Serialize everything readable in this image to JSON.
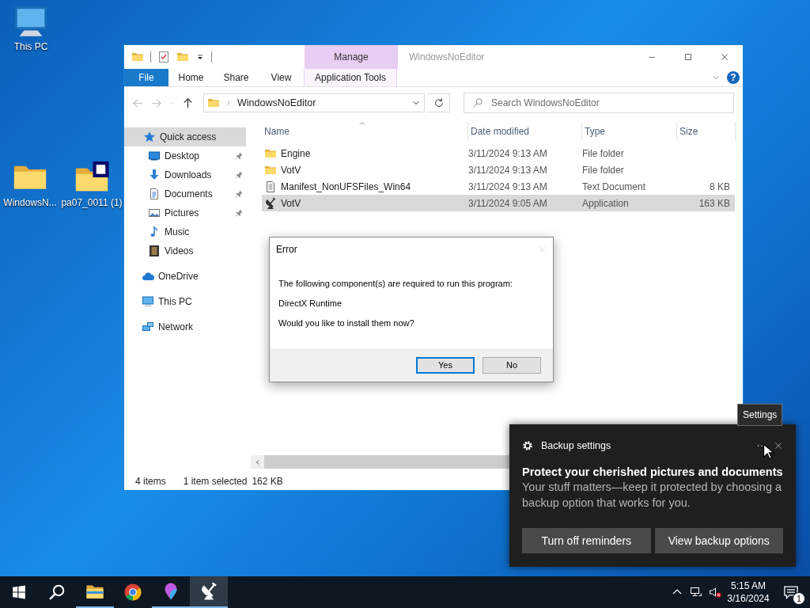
{
  "desktop_icons": [
    {
      "kind": "computer",
      "label": "This PC"
    },
    {
      "kind": "folder",
      "label": "WindowsN..."
    },
    {
      "kind": "archive",
      "label": "pa07_0011 (1)"
    }
  ],
  "explorer": {
    "contextual_group": "Manage",
    "title": "WindowsNoEditor",
    "ribbon_tabs": [
      {
        "kind": "file",
        "label": "File"
      },
      {
        "kind": "plain",
        "label": "Home"
      },
      {
        "kind": "plain",
        "label": "Share"
      },
      {
        "kind": "plain",
        "label": "View"
      },
      {
        "kind": "contextual",
        "label": "Application Tools"
      }
    ],
    "help": "?",
    "address": "WindowsNoEditor",
    "search": {
      "placeholder": "Search WindowsNoEditor"
    },
    "nav": [
      {
        "kind": "star",
        "label": "Quick access",
        "selected": true,
        "children": [
          {
            "kind": "desktop",
            "label": "Desktop",
            "pinned": true,
            "selected": false
          },
          {
            "kind": "download",
            "label": "Downloads",
            "pinned": true,
            "selected": false
          },
          {
            "kind": "document",
            "label": "Documents",
            "pinned": true,
            "selected": false
          },
          {
            "kind": "pictures",
            "label": "Pictures",
            "pinned": true,
            "selected": false
          },
          {
            "kind": "music",
            "label": "Music",
            "pinned": false,
            "selected": false
          },
          {
            "kind": "video",
            "label": "Videos",
            "pinned": false,
            "selected": false
          }
        ]
      },
      {
        "kind": "cloud",
        "label": "OneDrive",
        "selected": false
      },
      {
        "kind": "computer",
        "label": "This PC",
        "selected": false
      },
      {
        "kind": "network",
        "label": "Network",
        "selected": false
      }
    ],
    "columns": [
      "Name",
      "Date modified",
      "Type",
      "Size"
    ],
    "rows": [
      {
        "kind": "folder",
        "name": "Engine",
        "date": "3/11/2024 9:13 AM",
        "type": "File folder",
        "selected": false
      },
      {
        "kind": "folder",
        "name": "VotV",
        "date": "3/11/2024 9:13 AM",
        "type": "File folder",
        "selected": false
      },
      {
        "kind": "text",
        "name": "Manifest_NonUFSFiles_Win64",
        "date": "3/11/2024 9:13 AM",
        "type": "Text Document",
        "size": "8 KB",
        "selected": false
      },
      {
        "kind": "app",
        "name": "VotV",
        "date": "3/11/2024 9:05 AM",
        "type": "Application",
        "size": "163 KB",
        "selected": true
      }
    ],
    "status": {
      "count": "4 items",
      "selection": "1 item selected",
      "size": "162 KB"
    }
  },
  "dialog": {
    "title": "Error",
    "lines": [
      "The following component(s) are required to run this program:",
      "DirectX Runtime",
      "Would you like to install them now?"
    ],
    "buttons": [
      {
        "label": "Yes",
        "selected": true
      },
      {
        "label": "No",
        "selected": false
      }
    ]
  },
  "tooltip": "Settings",
  "toast": {
    "app": "Backup settings",
    "title": "Protect your cherished pictures and documents",
    "body": "Your stuff matters—keep it protected by choosing a backup option that works for you.",
    "buttons": [
      "Turn off reminders",
      "View backup options"
    ]
  },
  "taskbar": {
    "apps": [
      {
        "kind": "explorer",
        "running": true,
        "active": false
      },
      {
        "kind": "chrome",
        "running": false,
        "active": false
      },
      {
        "kind": "maps",
        "running": true,
        "active": false
      },
      {
        "kind": "dish",
        "running": true,
        "active": true
      }
    ],
    "time": "5:15 AM",
    "date": "3/16/2024",
    "notifications": "1"
  }
}
